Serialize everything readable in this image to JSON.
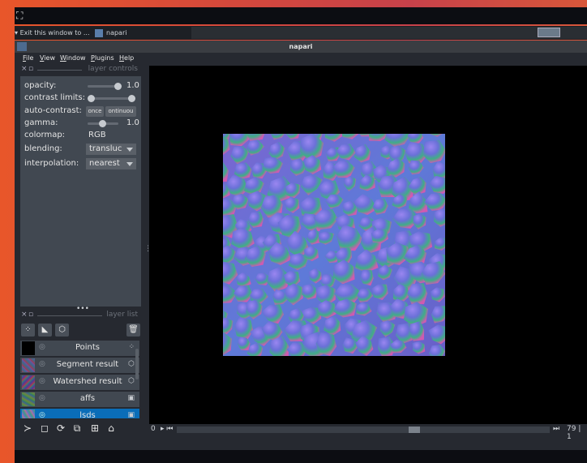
{
  "taskbar": {
    "item1": "Exit this window to ...",
    "item2": "napari"
  },
  "window": {
    "title": "napari"
  },
  "menu": [
    "File",
    "View",
    "Window",
    "Plugins",
    "Help"
  ],
  "layer_controls": {
    "header": "layer controls",
    "opacity_label": "opacity:",
    "opacity_value": "1.0",
    "contrast_label": "contrast limits:",
    "autocontrast_label": "auto-contrast:",
    "autocontrast_once": "once",
    "autocontrast_continuous": "ontinuou",
    "gamma_label": "gamma:",
    "gamma_value": "1.0",
    "colormap_label": "colormap:",
    "colormap_value": "RGB",
    "blending_label": "blending:",
    "blending_value": "transluc",
    "interpolation_label": "interpolation:",
    "interpolation_value": "nearest"
  },
  "layer_list": {
    "header": "layer list",
    "layers": [
      {
        "name": "Points",
        "type_icon": "points-icon"
      },
      {
        "name": "Segment result",
        "type_icon": "tag-icon"
      },
      {
        "name": "Watershed result",
        "type_icon": "tag-icon"
      },
      {
        "name": "affs",
        "type_icon": "image-icon"
      },
      {
        "name": "lsds",
        "type_icon": "image-icon",
        "selected": true
      }
    ]
  },
  "dims": {
    "start": "0",
    "current": "79",
    "after": "1"
  },
  "colors": {
    "panel": "#414851",
    "background": "#262930",
    "accent": "#0a6db8"
  }
}
